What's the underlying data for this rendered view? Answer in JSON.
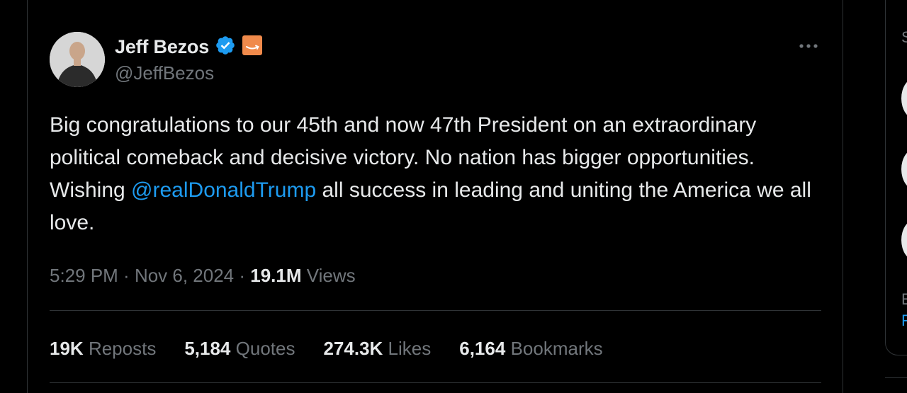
{
  "author": {
    "name": "Jeff Bezos",
    "handle": "@JeffBezos",
    "verified_icon": "verified-badge-icon",
    "affiliation_icon": "amazon-logo-icon",
    "colors": {
      "verified": "#1d9bf0",
      "affiliation": "#f08a4b"
    }
  },
  "tweet": {
    "text_before": "Big congratulations to our 45th and now 47th President on an extraordinary political comeback and decisive victory. No nation has bigger opportunities. Wishing ",
    "mention": "@realDonaldTrump",
    "text_after": " all success in leading and uniting the America we all love."
  },
  "meta": {
    "time": "5:29 PM",
    "separator": " · ",
    "date": "Nov 6, 2024",
    "views_count": "19.1M",
    "views_label": " Views"
  },
  "stats": [
    {
      "count": "19K",
      "label": "Reposts"
    },
    {
      "count": "5,184",
      "label": "Quotes"
    },
    {
      "count": "274.3K",
      "label": "Likes"
    },
    {
      "count": "6,164",
      "label": "Bookmarks"
    }
  ],
  "more_icon": "more-horizontal-icon",
  "sidebar_fragment": {
    "letter_top": "S",
    "letter_e": "E",
    "letter_f": "F"
  }
}
